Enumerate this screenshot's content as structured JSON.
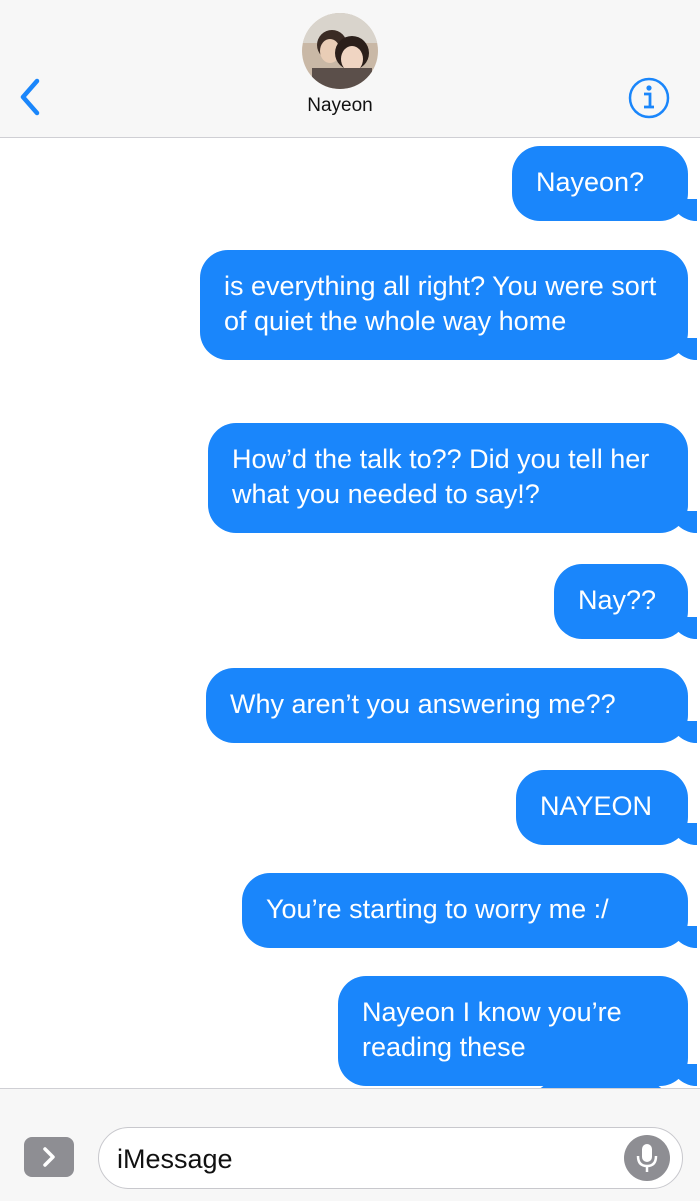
{
  "header": {
    "contact_name": "Nayeon",
    "accent_color": "#1a86fb",
    "back_icon": "chevron-left-icon",
    "info_icon": "info-icon"
  },
  "messages": [
    {
      "text": "Nayeon?"
    },
    {
      "text": "is everything all right? You were sort of quiet the whole way home"
    },
    {
      "text": "How’d the talk to?? Did you tell her what you needed to say!?"
    },
    {
      "text": "Nay??"
    },
    {
      "text": "Why aren’t you answering me??"
    },
    {
      "text": "NAYEON"
    },
    {
      "text": "You’re starting to worry me :/"
    },
    {
      "text": "Nayeon I know you’re reading these"
    }
  ],
  "input_bar": {
    "placeholder": "iMessage",
    "apps_icon": "chevron-right-icon",
    "mic_icon": "microphone-icon"
  }
}
